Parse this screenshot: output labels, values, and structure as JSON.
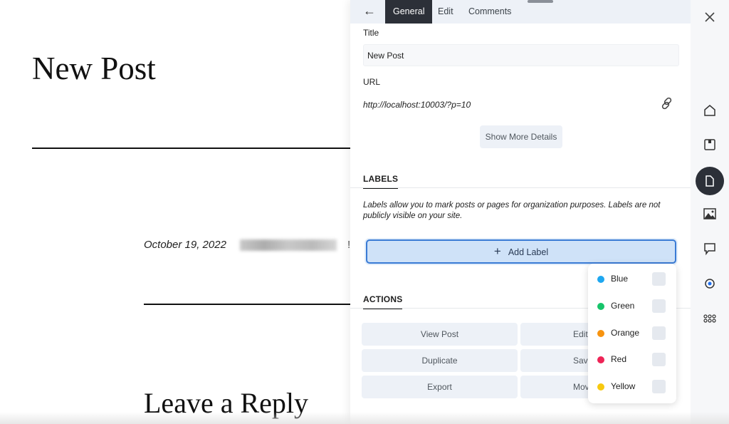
{
  "post": {
    "title": "New Post",
    "date": "October 19, 2022",
    "author_hint": "!",
    "reply_heading": "Leave a Reply"
  },
  "panel": {
    "tabs": [
      {
        "label": "General",
        "active": true
      },
      {
        "label": "Edit"
      },
      {
        "label": "Comments"
      }
    ],
    "title_label": "Title",
    "title_value": "New Post",
    "url_label": "URL",
    "url_value": "http://localhost:10003/?p=10",
    "show_more": "Show More Details",
    "labels_heading": "LABELS",
    "labels_desc": "Labels allow you to mark posts or pages for organization purposes. Labels are not publicly visible on your site.",
    "add_label": "Add Label",
    "actions_heading": "ACTIONS",
    "actions": [
      "View Post",
      "Edit",
      "Duplicate",
      "Save",
      "Export",
      "Move"
    ]
  },
  "label_options": [
    {
      "name": "Blue",
      "color": "#1ea7f0",
      "checked": false
    },
    {
      "name": "Green",
      "color": "#17c46a",
      "checked": false
    },
    {
      "name": "Orange",
      "color": "#f7930f",
      "checked": false
    },
    {
      "name": "Red",
      "color": "#ee2456",
      "checked": false
    },
    {
      "name": "Yellow",
      "color": "#f7c90f",
      "checked": false
    }
  ],
  "rail": {
    "icons": [
      "home-icon",
      "bookmark-icon",
      "page-icon",
      "media-icon",
      "comment-icon",
      "sync-icon",
      "apps-icon"
    ],
    "active": "page-icon"
  }
}
